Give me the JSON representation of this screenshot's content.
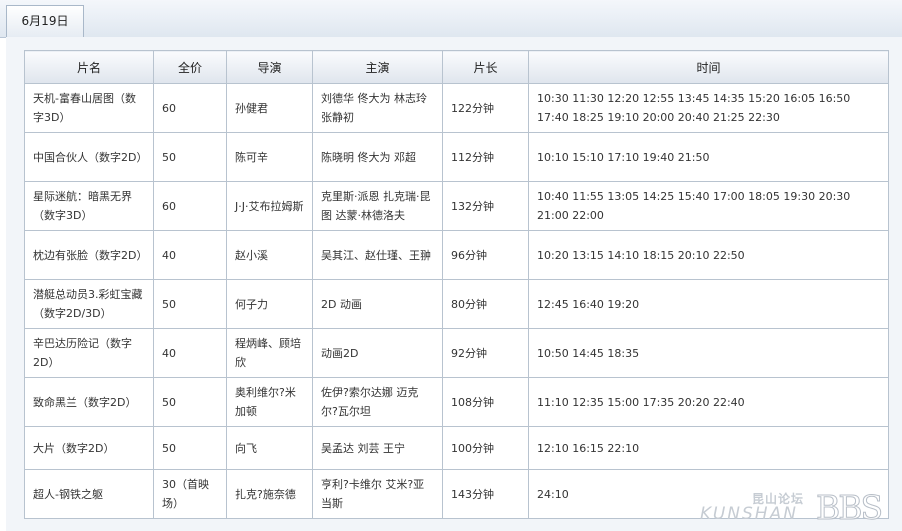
{
  "tab": {
    "label": "6月19日"
  },
  "table": {
    "headers": [
      "片名",
      "全价",
      "导演",
      "主演",
      "片长",
      "时间"
    ],
    "rows": [
      {
        "title": "天机-富春山居图（数字3D）",
        "price": "60",
        "director": "孙健君",
        "cast": "刘德华 佟大为 林志玲 张静初",
        "duration": "122分钟",
        "times": "10:30 11:30 12:20 12:55 13:45 14:35 15:20 16:05 16:50 17:40 18:25 19:10 20:00 20:40 21:25 22:30"
      },
      {
        "title": "中国合伙人（数字2D）",
        "price": "50",
        "director": "陈可辛",
        "cast": "陈晓明 佟大为 邓超",
        "duration": "112分钟",
        "times": "10:10 15:10 17:10 19:40 21:50"
      },
      {
        "title": "星际迷航：暗黑无界（数字3D）",
        "price": "60",
        "director": "J·J·艾布拉姆斯",
        "cast": "克里斯·派恩 扎克瑞·昆图 达蒙·林德洛夫",
        "duration": "132分钟",
        "times": "10:40 11:55 13:05 14:25 15:40 17:00 18:05 19:30 20:30 21:00 22:00"
      },
      {
        "title": "枕边有张脸（数字2D）",
        "price": "40",
        "director": "赵小溪",
        "cast": "吴其江、赵仕瑾、王翀",
        "duration": "96分钟",
        "times": "10:20 13:15 14:10 18:15 20:10 22:50"
      },
      {
        "title": "潜艇总动员3.彩虹宝藏（数字2D/3D）",
        "price": "50",
        "director": "何子力",
        "cast": "2D 动画",
        "duration": "80分钟",
        "times": "12:45 16:40 19:20"
      },
      {
        "title": "辛巴达历险记（数字2D）",
        "price": "40",
        "director": "程炳峰、顾培欣",
        "cast": "动画2D",
        "duration": "92分钟",
        "times": "10:50 14:45 18:35"
      },
      {
        "title": "致命黑兰（数字2D）",
        "price": "50",
        "director": "奥利维尔?米加顿",
        "cast": "佐伊?索尔达娜 迈克尔?瓦尔坦",
        "duration": "108分钟",
        "times": "11:10 12:35 15:00 17:35 20:20 22:40"
      },
      {
        "title": "大片（数字2D）",
        "price": "50",
        "director": "向飞",
        "cast": "吴孟达 刘芸 王宁",
        "duration": "100分钟",
        "times": "12:10 16:15 22:10"
      },
      {
        "title": "超人-钢铁之躯",
        "price": "30（首映场）",
        "director": "扎克?施奈德",
        "cast": "亨利?卡维尔 艾米?亚当斯",
        "duration": "143分钟",
        "times": "24:10"
      }
    ]
  },
  "watermark": {
    "cn": "昆山论坛",
    "en": "KUNSHAN",
    "bbs": "BBS"
  }
}
